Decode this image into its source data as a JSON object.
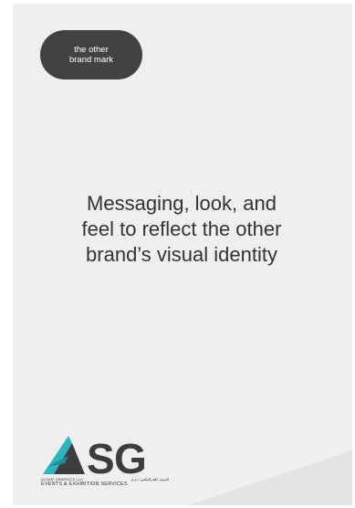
{
  "badge": {
    "line1": "the other",
    "line2": "brand mark"
  },
  "headline": {
    "line1": "Messaging, look, and",
    "line2": "feel to reflect the other",
    "line3": "brand’s visual identity"
  },
  "logo": {
    "mark": "ASG",
    "company": "ALSAIF GRAPHICS LLC",
    "company_arabic": "السيف للجرافيكس ذ.م.م",
    "services": "EVENTS & EXHIBITION SERVICES"
  },
  "colors": {
    "page": "#efefef",
    "badge": "#424242",
    "headline": "#333333",
    "accent": "#2bb3c0",
    "logo_dark": "#3d3d3d"
  }
}
